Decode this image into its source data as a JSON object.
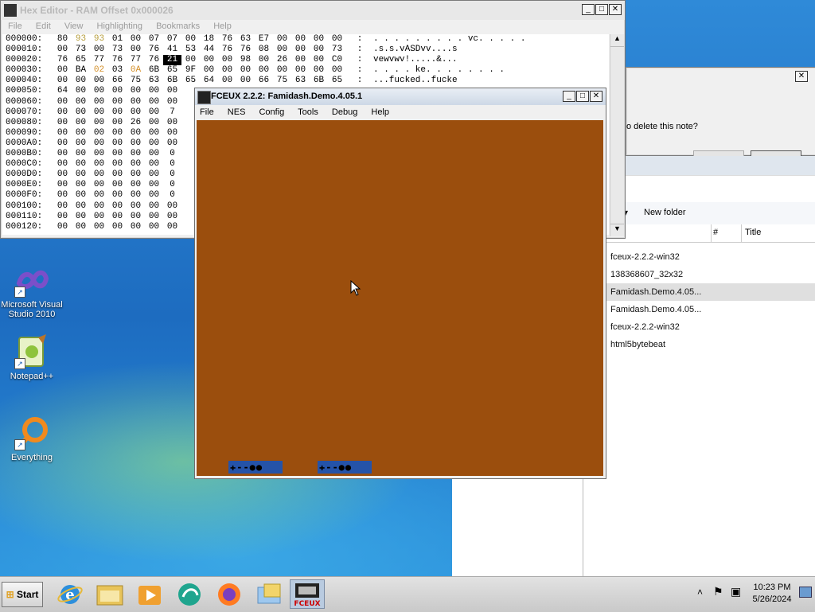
{
  "desktop": {
    "icons": [
      {
        "label": "Microsoft Visual Studio 2010",
        "icon": "visual-studio-icon"
      },
      {
        "label": "Notepad++",
        "icon": "notepadpp-icon"
      },
      {
        "label": "Everything",
        "icon": "everything-icon"
      }
    ]
  },
  "hex_editor": {
    "title": "Hex Editor - RAM Offset 0x000026",
    "menu": [
      "File",
      "Edit",
      "View",
      "Highlighting",
      "Bookmarks",
      "Help"
    ],
    "rows": [
      {
        "addr": "000000:",
        "bytes": [
          "80",
          "93",
          "93",
          "01",
          "00",
          "07",
          "07",
          "00",
          "18",
          "76",
          "63",
          "E7",
          "00",
          "00",
          "00",
          "00"
        ],
        "ascii": ". . . . . . . . . vc. . . . ."
      },
      {
        "addr": "000010:",
        "bytes": [
          "00",
          "73",
          "00",
          "73",
          "00",
          "76",
          "41",
          "53",
          "44",
          "76",
          "76",
          "08",
          "00",
          "00",
          "00",
          "73"
        ],
        "ascii": ".s.s.vASDvv....s"
      },
      {
        "addr": "000020:",
        "bytes": [
          "76",
          "65",
          "77",
          "76",
          "77",
          "76",
          "21",
          "00",
          "00",
          "00",
          "98",
          "00",
          "26",
          "00",
          "00",
          "C0"
        ],
        "ascii": "vewvwv!.....&..."
      },
      {
        "addr": "000030:",
        "bytes": [
          "00",
          "BA",
          "02",
          "03",
          "0A",
          "6B",
          "65",
          "9F",
          "00",
          "00",
          "00",
          "00",
          "00",
          "00",
          "00",
          "00"
        ],
        "ascii": ". . . . ke. . . . . . . ."
      },
      {
        "addr": "000040:",
        "bytes": [
          "00",
          "00",
          "00",
          "66",
          "75",
          "63",
          "6B",
          "65",
          "64",
          "00",
          "00",
          "66",
          "75",
          "63",
          "6B",
          "65"
        ],
        "ascii": "...fucked..fucke"
      },
      {
        "addr": "000050:",
        "bytes": [
          "64",
          "00",
          "00",
          "00",
          "00",
          "00",
          "00"
        ]
      },
      {
        "addr": "000060:",
        "bytes": [
          "00",
          "00",
          "00",
          "00",
          "00",
          "00",
          "00"
        ]
      },
      {
        "addr": "000070:",
        "bytes": [
          "00",
          "00",
          "00",
          "00",
          "00",
          "00",
          "7"
        ]
      },
      {
        "addr": "000080:",
        "bytes": [
          "00",
          "00",
          "00",
          "00",
          "26",
          "00",
          "00"
        ]
      },
      {
        "addr": "000090:",
        "bytes": [
          "00",
          "00",
          "00",
          "00",
          "00",
          "00",
          "00"
        ]
      },
      {
        "addr": "0000A0:",
        "bytes": [
          "00",
          "00",
          "00",
          "00",
          "00",
          "00",
          "00"
        ]
      },
      {
        "addr": "0000B0:",
        "bytes": [
          "00",
          "00",
          "00",
          "00",
          "00",
          "00",
          "0"
        ]
      },
      {
        "addr": "0000C0:",
        "bytes": [
          "00",
          "00",
          "00",
          "00",
          "00",
          "00",
          "0"
        ]
      },
      {
        "addr": "0000D0:",
        "bytes": [
          "00",
          "00",
          "00",
          "00",
          "00",
          "00",
          "0"
        ]
      },
      {
        "addr": "0000E0:",
        "bytes": [
          "00",
          "00",
          "00",
          "00",
          "00",
          "00",
          "0"
        ]
      },
      {
        "addr": "0000F0:",
        "bytes": [
          "00",
          "00",
          "00",
          "00",
          "00",
          "00",
          "0"
        ]
      },
      {
        "addr": "000100:",
        "bytes": [
          "00",
          "00",
          "00",
          "00",
          "00",
          "00",
          "00"
        ]
      },
      {
        "addr": "000110:",
        "bytes": [
          "00",
          "00",
          "00",
          "00",
          "00",
          "00",
          "00"
        ]
      },
      {
        "addr": "000120:",
        "bytes": [
          "00",
          "00",
          "00",
          "00",
          "00",
          "00",
          "00"
        ]
      }
    ],
    "colors": {
      "yellow": "#b8a040",
      "orange": "#d4902a"
    }
  },
  "dialog": {
    "text": "o delete this note?"
  },
  "explorer": {
    "toolbar_item": "New folder",
    "columns": [
      "#",
      "Title"
    ],
    "files": [
      {
        "name": "fceux-2.2.2-win32",
        "selected": false
      },
      {
        "name": "138368607_32x32",
        "selected": false
      },
      {
        "name": "Famidash.Demo.4.05...",
        "selected": true
      },
      {
        "name": "Famidash.Demo.4.05...",
        "selected": false
      },
      {
        "name": "fceux-2.2.2-win32",
        "selected": false
      },
      {
        "name": "html5bytebeat",
        "selected": false
      }
    ]
  },
  "fceux": {
    "title": "FCEUX 2.2.2: Famidash.Demo.4.05.1",
    "menu": [
      "File",
      "NES",
      "Config",
      "Tools",
      "Debug",
      "Help"
    ],
    "game_bg": "#9b4e0d",
    "controllers": [
      "✚--●●",
      "✚--●●"
    ]
  },
  "taskbar": {
    "start_label": "Start",
    "apps": [
      "internet-explorer-icon",
      "explorer-icon",
      "media-player-icon",
      "app-icon",
      "firefox-icon",
      "folder-icon",
      "fceux-icon"
    ],
    "time": "10:23 PM",
    "date": "5/26/2024"
  }
}
